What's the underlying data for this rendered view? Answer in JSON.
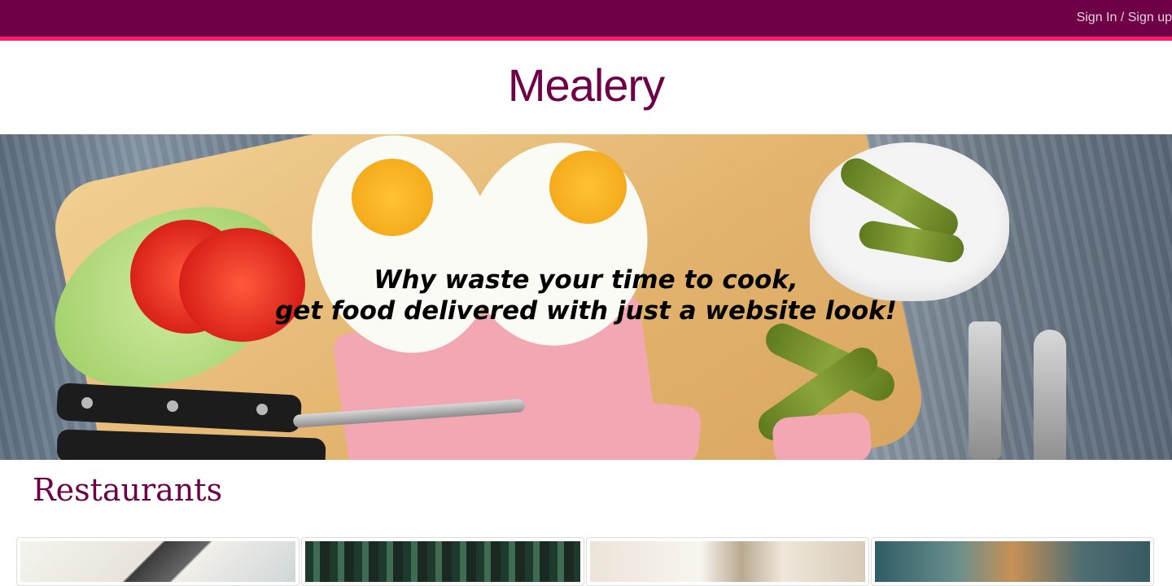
{
  "header": {
    "signin_label": "Sign In / Sign up",
    "accent_color": "#6e0047",
    "stripe_color": "#ff1a63"
  },
  "brand": {
    "title": "Mealery"
  },
  "hero": {
    "tagline_line1": "Why waste your time to cook,",
    "tagline_line2": "get food delivered with just a website look!"
  },
  "restaurants": {
    "title": "Restaurants",
    "cards": [
      {
        "image": "restaurant-photo"
      },
      {
        "image": "restaurant-photo"
      },
      {
        "image": "restaurant-photo"
      },
      {
        "image": "restaurant-photo"
      }
    ]
  }
}
